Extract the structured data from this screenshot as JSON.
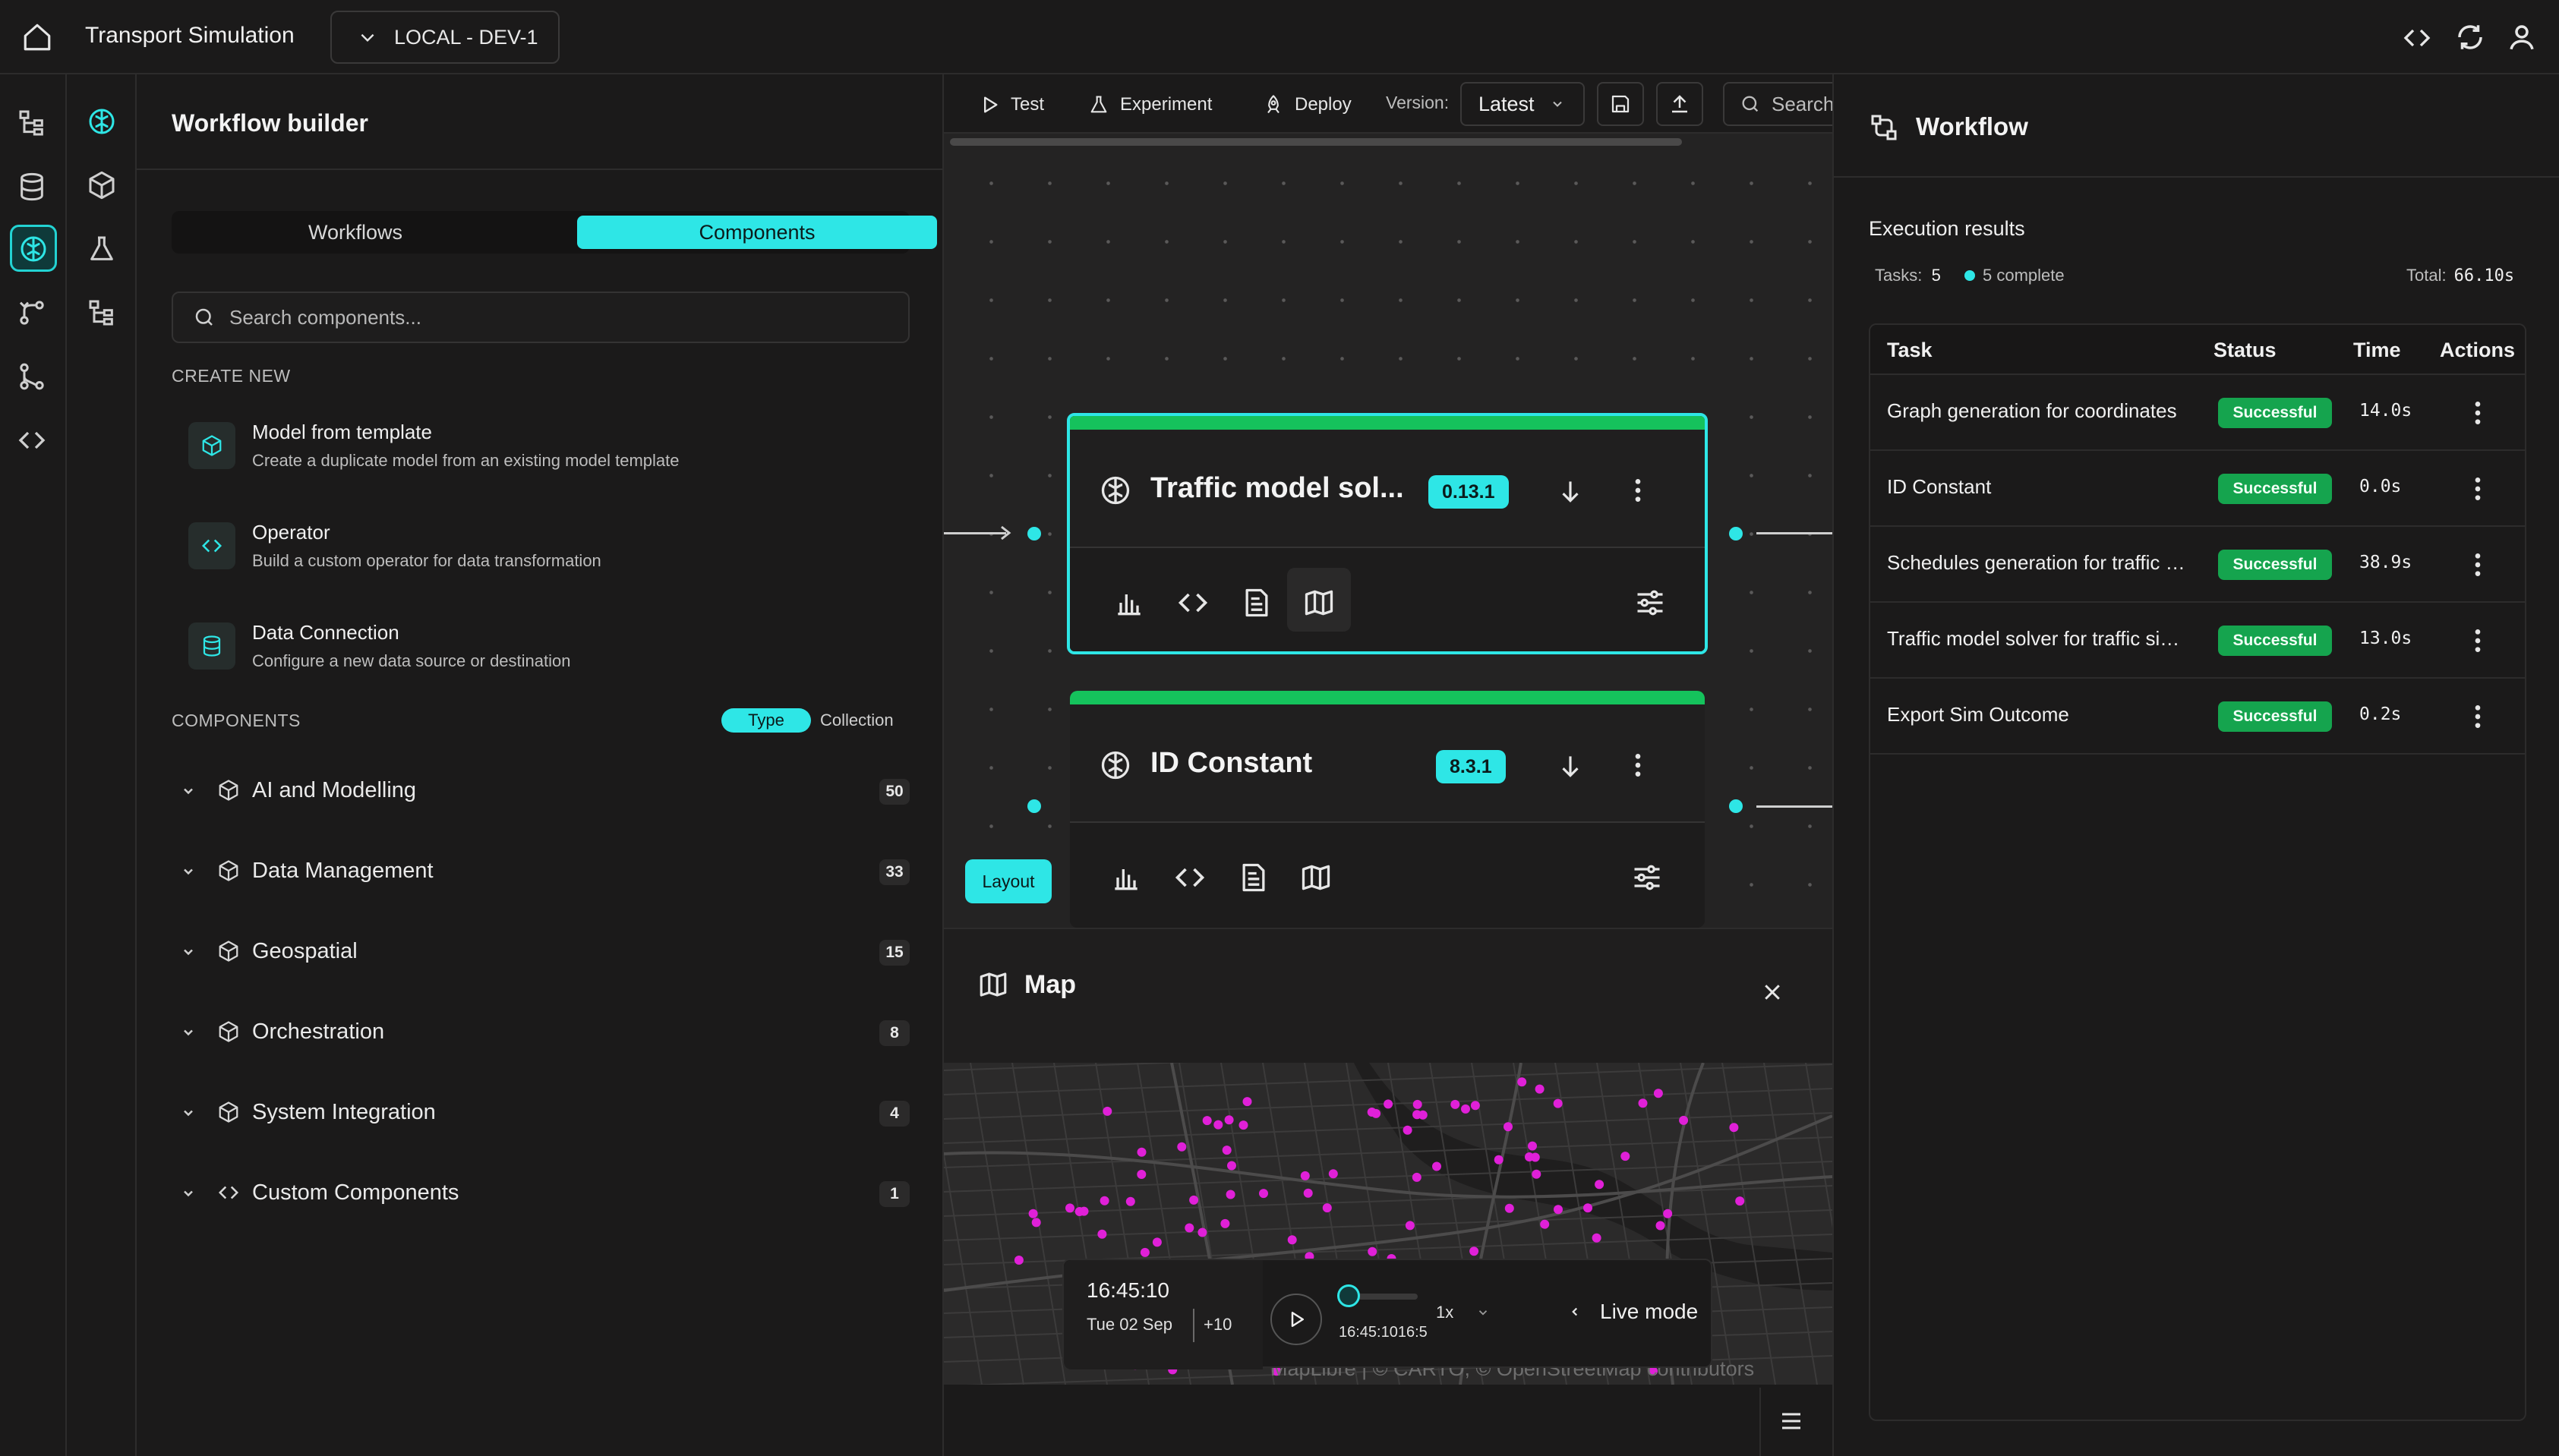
{
  "app": {
    "title": "Transport Simulation",
    "environment": "LOCAL - DEV-1"
  },
  "builder": {
    "title": "Workflow builder",
    "tabs": {
      "workflows": "Workflows",
      "components": "Components"
    },
    "search_placeholder": "Search components...",
    "create_new_label": "CREATE NEW",
    "create_items": [
      {
        "title": "Model from template",
        "desc": "Create a duplicate model from an existing model template",
        "icon": "cube-icon"
      },
      {
        "title": "Operator",
        "desc": "Build a custom operator for data transformation",
        "icon": "code-icon"
      },
      {
        "title": "Data Connection",
        "desc": "Configure a new data source or destination",
        "icon": "database-icon"
      }
    ],
    "components_label": "COMPONENTS",
    "view_toggle": {
      "type": "Type",
      "collection": "Collection"
    },
    "categories": [
      {
        "name": "AI and Modelling",
        "count": "50",
        "icon": "cube-icon"
      },
      {
        "name": "Data Management",
        "count": "33",
        "icon": "cube-icon"
      },
      {
        "name": "Geospatial",
        "count": "15",
        "icon": "cube-icon"
      },
      {
        "name": "Orchestration",
        "count": "8",
        "icon": "cube-icon"
      },
      {
        "name": "System Integration",
        "count": "4",
        "icon": "cube-icon"
      },
      {
        "name": "Custom Components",
        "count": "1",
        "icon": "code-icon"
      }
    ]
  },
  "canvas": {
    "toolbar": {
      "test": "Test",
      "experiment": "Experiment",
      "deploy": "Deploy",
      "version_label": "Version:",
      "version_value": "Latest",
      "search_placeholder": "Search"
    },
    "nodes": [
      {
        "title": "Traffic model sol...",
        "version": "0.13.1",
        "selected": true
      },
      {
        "title": "ID Constant",
        "version": "8.3.1",
        "selected": false
      }
    ],
    "layout_button": "Layout"
  },
  "map": {
    "title": "Map",
    "attribution": "MapLibre | © CARTO, © OpenStreetMap contributors",
    "time": "16:45:10",
    "date": "Tue 02 Sep",
    "timezone": "+10",
    "timeline_time": "16:45:1016:5",
    "speed": "1x",
    "live_mode": "Live mode",
    "marker_color": "#e020d8"
  },
  "workflow": {
    "title": "Workflow",
    "subtitle": "Execution results",
    "tasks_label": "Tasks:",
    "tasks_count": "5",
    "complete_text": "5 complete",
    "total_label": "Total:",
    "total_value": "66.10s",
    "columns": [
      "Task",
      "Status",
      "Time",
      "Actions"
    ],
    "rows": [
      {
        "task": "Graph generation for coordinates",
        "status": "Successful",
        "time": "14.0s"
      },
      {
        "task": "ID Constant",
        "status": "Successful",
        "time": "0.0s"
      },
      {
        "task": "Schedules generation for traffic simulation",
        "status": "Successful",
        "time": "38.9s"
      },
      {
        "task": "Traffic model solver for traffic simulation",
        "status": "Successful",
        "time": "13.0s"
      },
      {
        "task": "Export Sim Outcome",
        "status": "Successful",
        "time": "0.2s"
      }
    ]
  },
  "colors": {
    "accent": "#2ee6e6",
    "success": "#15a44e",
    "node_stripe": "#15c25c",
    "background": "#1b1a1a"
  }
}
